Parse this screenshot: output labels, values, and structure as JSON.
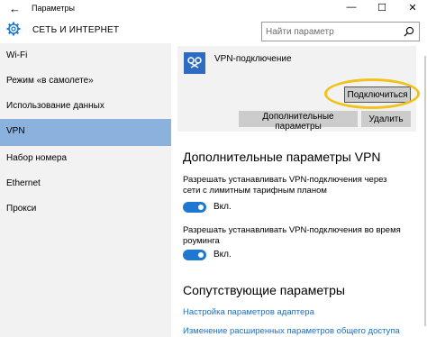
{
  "window": {
    "title": "Параметры",
    "back_icon": "back-arrow-icon",
    "minimize_glyph": "—",
    "maximize_glyph": "☐",
    "close_glyph": "✕"
  },
  "header": {
    "icon": "gear-icon",
    "title": "СЕТЬ И ИНТЕРНЕТ",
    "search_placeholder": "Найти параметр"
  },
  "sidebar": {
    "items": [
      {
        "label": "Wi-Fi"
      },
      {
        "label": "Режим «в самолете»"
      },
      {
        "label": "Использование данных"
      },
      {
        "label": "VPN",
        "active": true
      },
      {
        "label": "Набор номера"
      },
      {
        "label": "Ethernet"
      },
      {
        "label": "Прокси"
      }
    ]
  },
  "vpn": {
    "connection_name": "VPN-подключение",
    "connect_label": "Подключиться",
    "advanced_label": "Дополнительные параметры",
    "delete_label": "Удалить"
  },
  "advanced": {
    "title": "Дополнительные параметры VPN",
    "metered_text": "Разрешать устанавливать VPN-подключения через сети с лимитным тарифным планом",
    "metered_toggle": "Вкл.",
    "roaming_text": "Разрешать устанавливать VPN-подключения во время роуминга",
    "roaming_toggle": "Вкл."
  },
  "related": {
    "title": "Сопутствующие параметры",
    "link1": "Настройка параметров адаптера",
    "link2": "Изменение расширенных параметров общего доступа"
  },
  "colors": {
    "accent": "#1e78d3",
    "sidebar_active": "#8ab2dc",
    "highlight": "#f2c21c",
    "link": "#1a6fc4"
  }
}
